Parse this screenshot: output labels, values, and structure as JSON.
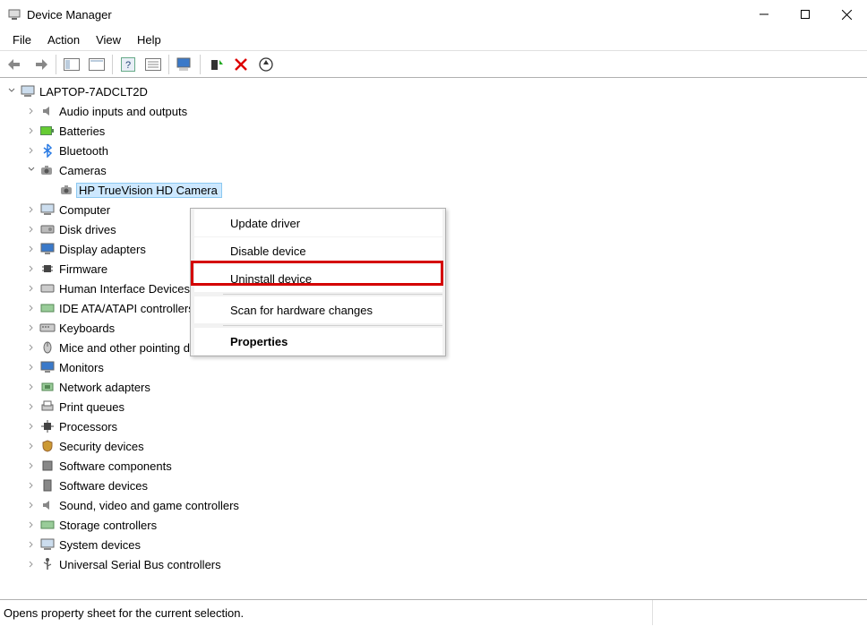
{
  "window": {
    "title": "Device Manager"
  },
  "menu": {
    "file": "File",
    "action": "Action",
    "view": "View",
    "help": "Help"
  },
  "tree": {
    "root": "LAPTOP-7ADCLT2D",
    "audio": "Audio inputs and outputs",
    "batteries": "Batteries",
    "bluetooth": "Bluetooth",
    "cameras": "Cameras",
    "hp_camera": "HP TrueVision HD Camera",
    "computer": "Computer",
    "disk_drives": "Disk drives",
    "display_adapters": "Display adapters",
    "firmware": "Firmware",
    "hid": "Human Interface Devices",
    "ide": "IDE ATA/ATAPI controllers",
    "keyboards": "Keyboards",
    "mice": "Mice and other pointing devices",
    "monitors": "Monitors",
    "network": "Network adapters",
    "print_queues": "Print queues",
    "processors": "Processors",
    "security": "Security devices",
    "sw_components": "Software components",
    "sw_devices": "Software devices",
    "sound": "Sound, video and game controllers",
    "storage": "Storage controllers",
    "system": "System devices",
    "usb": "Universal Serial Bus controllers"
  },
  "context_menu": {
    "update_driver": "Update driver",
    "disable_device": "Disable device",
    "uninstall_device": "Uninstall device",
    "scan": "Scan for hardware changes",
    "properties": "Properties"
  },
  "statusbar": {
    "text": "Opens property sheet for the current selection."
  }
}
